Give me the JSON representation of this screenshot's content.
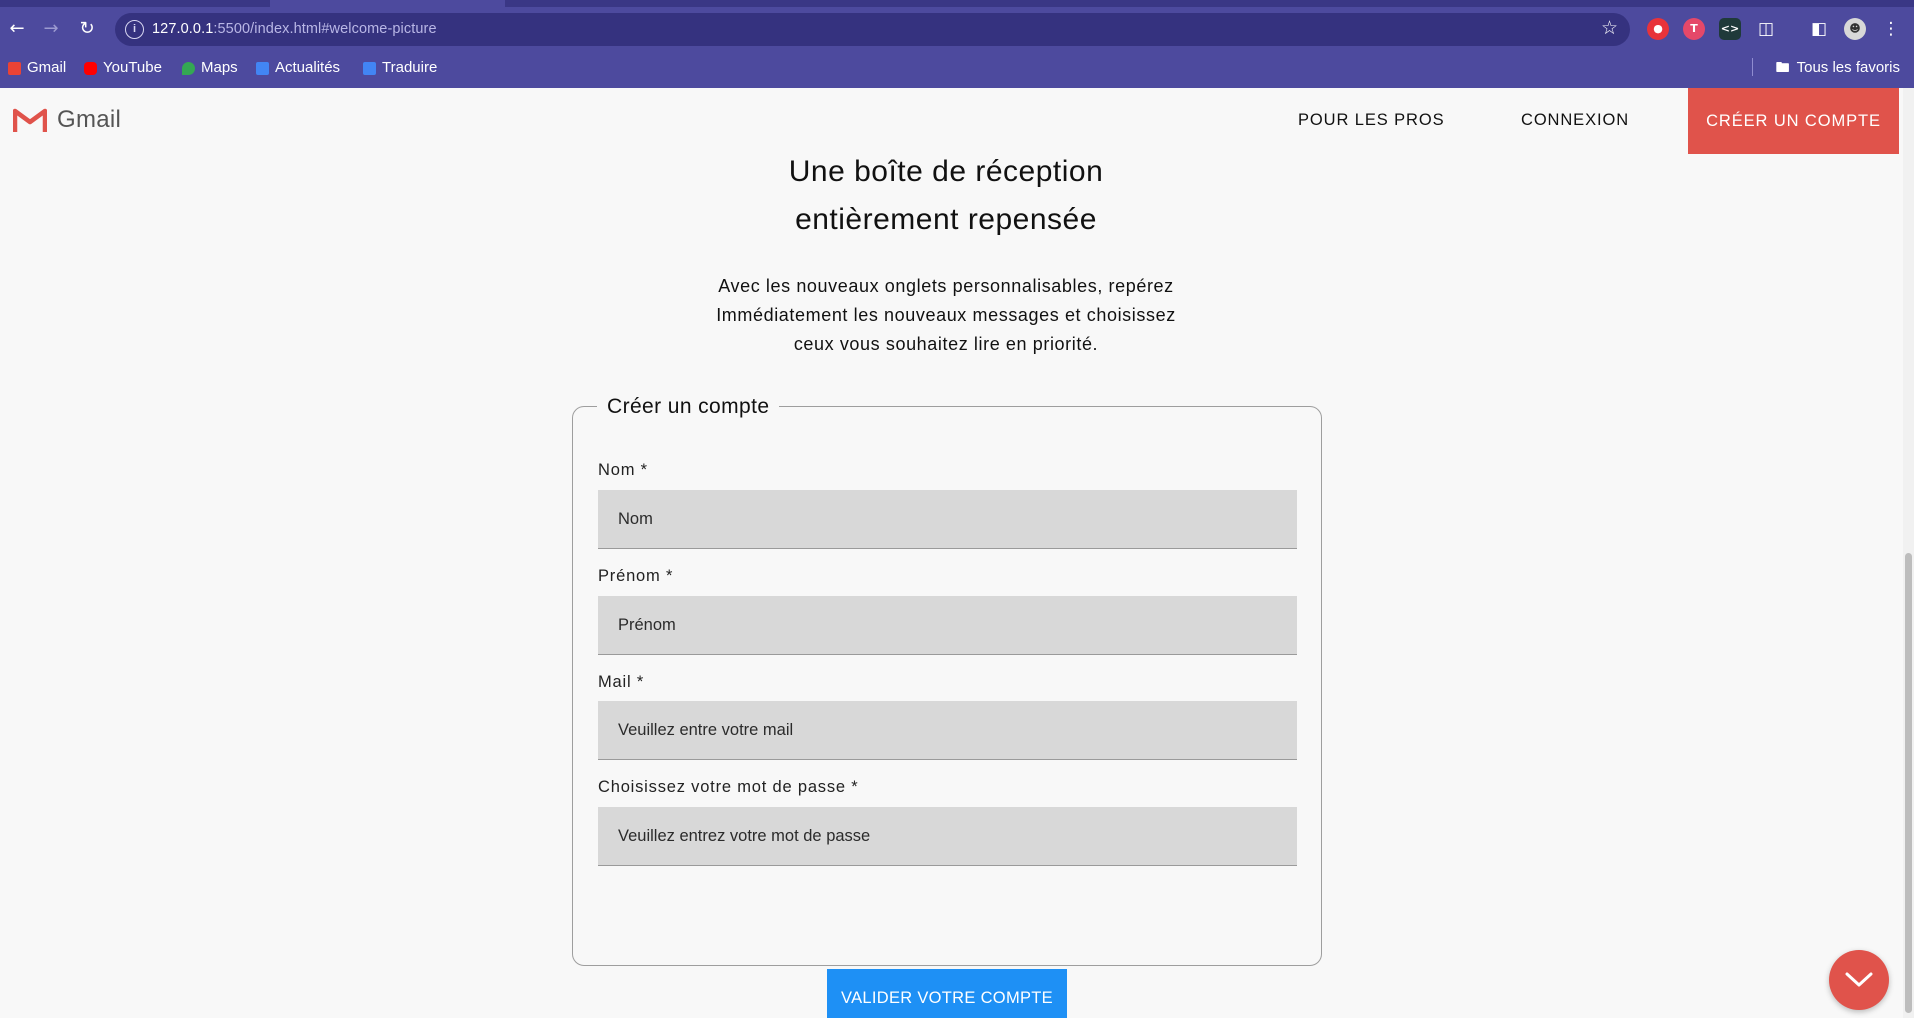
{
  "browser": {
    "url_host": "127.0.0.1",
    "url_path": ":5500/index.html#welcome-picture",
    "bookmarks": [
      {
        "label": "Gmail",
        "color": "#ea4335"
      },
      {
        "label": "YouTube",
        "color": "#ff0000"
      },
      {
        "label": "Maps",
        "color": "#34a853"
      },
      {
        "label": "Actualités",
        "color": "#4285f4"
      },
      {
        "label": "Traduire",
        "color": "#4285f4"
      }
    ],
    "all_bookmarks_label": "Tous les favoris"
  },
  "header": {
    "logo_text": "Gmail",
    "nav": {
      "pros": "POUR LES PROS",
      "login": "CONNEXION",
      "create": "CRÉER UN COMPTE"
    }
  },
  "hero": {
    "title_line1": "Une boîte de réception",
    "title_line2": "entièrement repensée",
    "text_line1": "Avec les nouveaux onglets personnalisables, repérez",
    "text_line2": "Immédiatement les nouveaux messages et choisissez",
    "text_line3": "ceux vous souhaitez lire en priorité."
  },
  "form": {
    "legend": "Créer un compte",
    "fields": [
      {
        "label": "Nom *",
        "placeholder": "Nom"
      },
      {
        "label": "Prénom *",
        "placeholder": "Prénom"
      },
      {
        "label": "Mail *",
        "placeholder": "Veuillez entre votre mail"
      },
      {
        "label": "Choisissez votre mot de passe *",
        "placeholder": "Veuillez entrez votre mot de passe"
      }
    ],
    "submit_label": "VALIDER VOTRE COMPTE"
  },
  "colors": {
    "brand_red": "#e0534b",
    "button_blue": "#1e90f5",
    "chrome_purple": "#4d4a9e"
  }
}
